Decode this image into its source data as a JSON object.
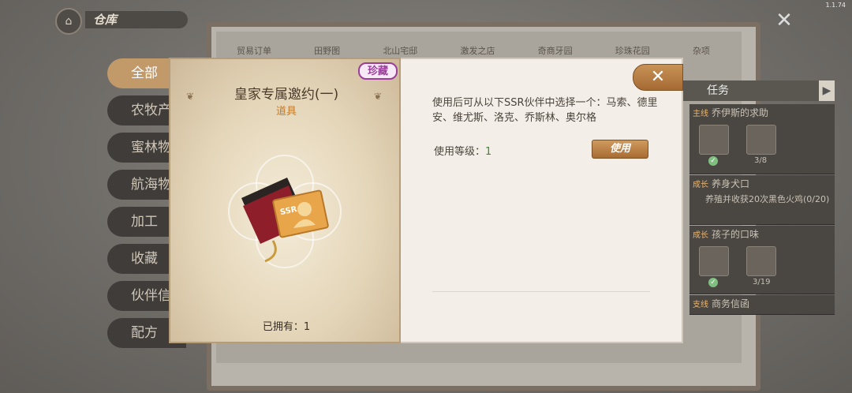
{
  "version": "1.1.74",
  "header": {
    "title": "仓库",
    "home_icon": "home-icon"
  },
  "side_menu": [
    {
      "label": "全部",
      "active": true
    },
    {
      "label": "农牧产"
    },
    {
      "label": "蜜林物"
    },
    {
      "label": "航海物"
    },
    {
      "label": "加工"
    },
    {
      "label": "收藏"
    },
    {
      "label": "伙伴信"
    },
    {
      "label": "配方"
    }
  ],
  "background_tabs": [
    "贸易订单",
    "田野图",
    "北山宅邸",
    "激发之店",
    "奇商牙园",
    "珍珠花园",
    "杂项"
  ],
  "tasks": {
    "header": "任务",
    "items": [
      {
        "tag": "主线",
        "name": "乔伊斯的求助",
        "count": "3/8"
      },
      {
        "tag": "成长",
        "name": "养身犬口",
        "desc": "养殖并收获20次黑色火鸡(0/20)"
      },
      {
        "tag": "成长",
        "name": "孩子的口味",
        "count": "3/19"
      },
      {
        "tag": "支线",
        "name": "商务信函"
      }
    ]
  },
  "dialog": {
    "badge": "珍藏",
    "item_name": "皇家专属邀约(一)",
    "item_type": "道具",
    "owned_label": "已拥有：1",
    "description": "使用后可从以下SSR伙伴中选择一个：马索、德里安、维尤斯、洛克、乔斯林、奥尔格",
    "level_label": "使用等级：",
    "level_value": "1",
    "use_button": "使用",
    "card_text": "SSR",
    "colors": {
      "badge": "#9a3e9a",
      "button": "#b87a3e",
      "level": "#3c8a2c",
      "type": "#c57a26"
    }
  }
}
